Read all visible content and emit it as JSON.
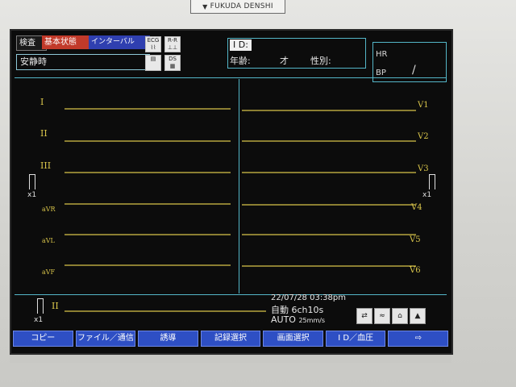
{
  "device": {
    "brand": "FUKUDA DENSHI"
  },
  "header": {
    "tabs": [
      "検査",
      "基本状態",
      "インターバル"
    ],
    "patient_name": "安静時",
    "id_label": "I D:",
    "age_label": "年齢:",
    "age_unit": "才",
    "sex_label": "性別:",
    "icons": [
      {
        "name": "ecg-icon",
        "label": "ECG"
      },
      {
        "name": "rr-icon",
        "label": "R-R"
      },
      {
        "name": "print-icon",
        "label": ""
      },
      {
        "name": "ds-icon",
        "label": "DS"
      }
    ]
  },
  "vitals": {
    "hr_label": "HR",
    "bp_label": "BP",
    "bp_value": "/"
  },
  "leads": {
    "left": [
      "I",
      "II",
      "III",
      "aVR",
      "aVL",
      "aVF"
    ],
    "right": [
      "V1",
      "V2",
      "V3",
      "V4",
      "V5",
      "V6"
    ],
    "rhythm": "II",
    "gain": "x1",
    "trace_color": "#d8c44a"
  },
  "status": {
    "datetime": "22/07/28 03:38pm",
    "mode": "自動 6ch10s",
    "auto": "AUTO",
    "speed": "25mm/s"
  },
  "softkeys": [
    "コピー",
    "ファイル／通信",
    "誘導",
    "記録選択",
    "画面選択",
    "I D／血圧",
    "⇨"
  ],
  "colors": {
    "frame": "#54b6c8",
    "softkey": "#2e4fc4",
    "tab_red": "#c23a2a",
    "tab_blue": "#2f3fb0"
  }
}
